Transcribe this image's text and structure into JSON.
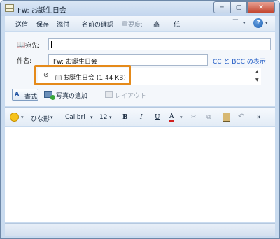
{
  "window": {
    "title": "Fw: お誕生日会",
    "controls": {
      "minimize": "─",
      "maximize": "▢",
      "close": "✕"
    }
  },
  "menu": {
    "send": "送信",
    "save": "保存",
    "attach": "添付",
    "check_names": "名前の確認",
    "importance": "重要度:",
    "high": "高",
    "low": "低",
    "caret": "▾",
    "help": "?"
  },
  "header": {
    "to_label": "宛先:",
    "to_value": "",
    "subject_label": "件名:",
    "subject_value": "Fw: お誕生日会",
    "cc_bcc_link": "CC と BCC の表示",
    "attachment": "お誕生日会 (1.44 KB)",
    "format_label": "書式",
    "format_icon": "A",
    "add_photo": "写真の追加",
    "layout": "レイアウト",
    "scroll_up": "▲",
    "scroll_down": "▼"
  },
  "format_toolbar": {
    "style": "ひな形",
    "font": "Calibri",
    "size": "12",
    "bold": "B",
    "italic": "I",
    "underline": "U",
    "font_color": "A",
    "cut": "✂",
    "copy": "⧉",
    "undo": "↶",
    "more": "»",
    "caret": "▾"
  },
  "colors": {
    "highlight": "#e58a1a",
    "link": "#1a57c4",
    "frame": "#c9dbef"
  },
  "icons": [
    "app-icon",
    "address-book-icon",
    "paperclip-icon",
    "attachment-file-icon",
    "format-icon",
    "photo-icon",
    "layout-icon",
    "emoticon-icon",
    "cut-icon",
    "copy-icon",
    "paste-icon",
    "undo-icon",
    "help-icon",
    "menu-icon"
  ]
}
